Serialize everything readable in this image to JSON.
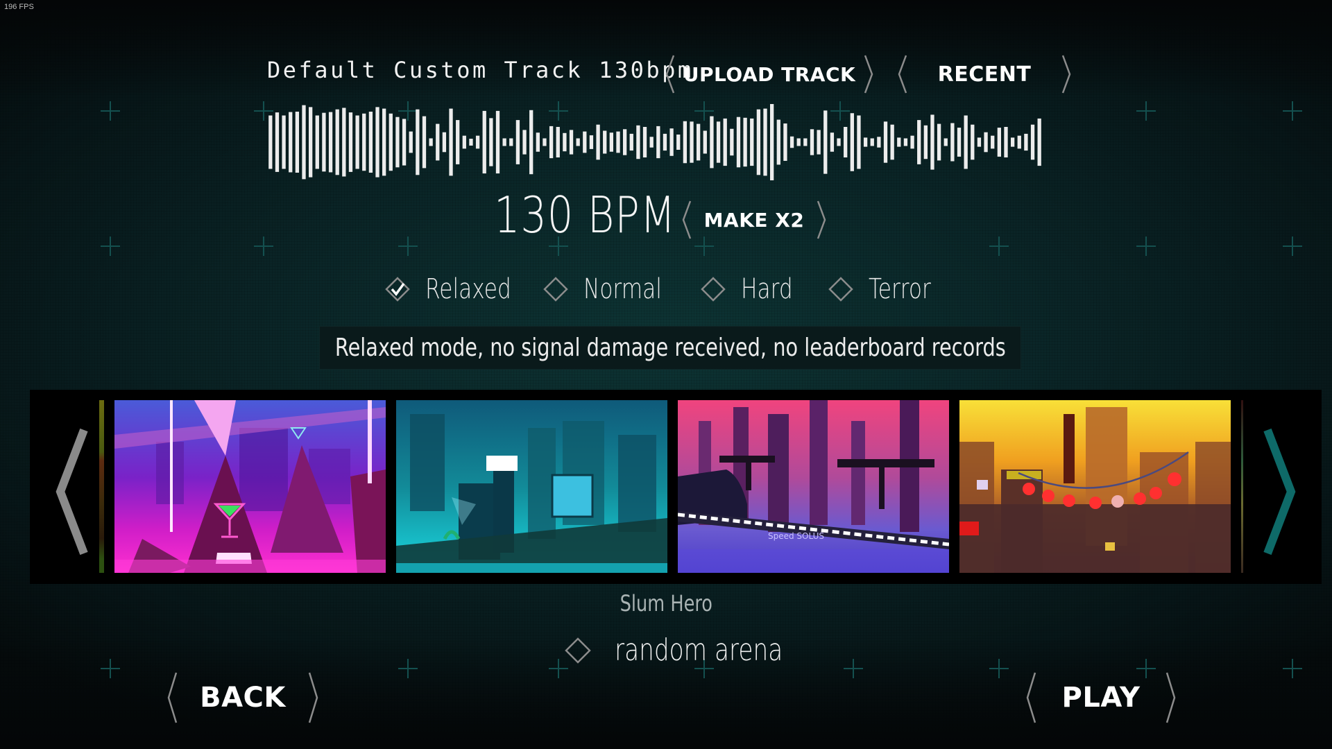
{
  "overlay": {
    "fps": "196 FPS"
  },
  "track": {
    "title": "Default Custom Track 130bpm",
    "bpm_display": "130 BPM",
    "waveform_levels": [
      0.7,
      0.78,
      0.7,
      0.79,
      0.8,
      0.97,
      0.92,
      0.7,
      0.77,
      0.79,
      0.86,
      0.9,
      0.78,
      0.7,
      0.75,
      0.8,
      0.92,
      0.88,
      0.75,
      0.66,
      0.61,
      0.28,
      0.86,
      0.68,
      0.1,
      0.48,
      0.26,
      0.88,
      0.58,
      0.17,
      0.09,
      0.17,
      0.82,
      0.63,
      0.82,
      0.1,
      0.1,
      0.58,
      0.32,
      0.84,
      0.25,
      0.1,
      0.42,
      0.4,
      0.24,
      0.32,
      0.1,
      0.28,
      0.18,
      0.46,
      0.3,
      0.25,
      0.28,
      0.34,
      0.22,
      0.44,
      0.4,
      0.14,
      0.42,
      0.22,
      0.36,
      0.2,
      0.55,
      0.54,
      0.48,
      0.3,
      0.68,
      0.54,
      0.62,
      0.35,
      0.66,
      0.64,
      0.62,
      0.86,
      0.88,
      1.0,
      0.59,
      0.49,
      0.15,
      0.1,
      0.1,
      0.34,
      0.32,
      0.83,
      0.25,
      0.1,
      0.4,
      0.76,
      0.7,
      0.12,
      0.1,
      0.14,
      0.54,
      0.46,
      0.12,
      0.1,
      0.17,
      0.58,
      0.44,
      0.72,
      0.48,
      0.1,
      0.5,
      0.38,
      0.7,
      0.46,
      0.12,
      0.26,
      0.17,
      0.38,
      0.4,
      0.12,
      0.17,
      0.22,
      0.46,
      0.62
    ],
    "colors": {
      "waveform": "#ececec"
    }
  },
  "buttons": {
    "upload": "Upload Track",
    "recent": "Recent",
    "make_x2": "Make x2",
    "back": "Back",
    "play": "Play"
  },
  "difficulty": {
    "options": [
      {
        "label": "Relaxed",
        "selected": true
      },
      {
        "label": "Normal",
        "selected": false
      },
      {
        "label": "Hard",
        "selected": false
      },
      {
        "label": "Terror",
        "selected": false
      }
    ],
    "description": "Relaxed mode, no signal damage received, no leaderboard records"
  },
  "arenas": {
    "items": [
      {
        "theme": "neon-pink-club"
      },
      {
        "theme": "teal-cyber-city"
      },
      {
        "theme": "pink-monorail-speed-solus",
        "sign_text": "Speed SOLUS"
      },
      {
        "theme": "sunset-lantern-slum"
      }
    ],
    "selected_name": "Slum Hero",
    "random_arena": {
      "label": "random arena",
      "checked": false
    },
    "colors": {
      "left_arrow": "#8a8a8a",
      "right_arrow": "#0e6a68"
    }
  }
}
